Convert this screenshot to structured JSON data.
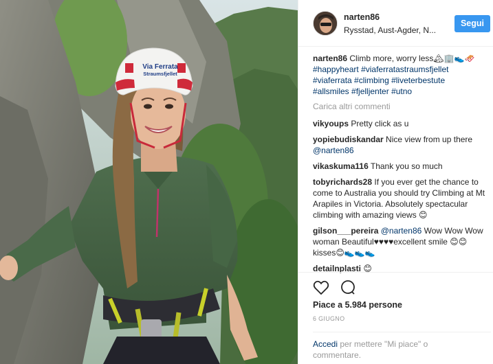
{
  "post": {
    "author": "narten86",
    "location": "Rysstad, Aust-Agder, N...",
    "follow_label": "Segui",
    "helmet_text_line1": "Via Ferrata",
    "helmet_text_line2": "Straumsfjellet"
  },
  "caption": {
    "user": "narten86",
    "text": "Climb more, worry less🏔🏢👟🛷",
    "hashtags": [
      "#happyheart",
      "#viaferratastraumsfjellet",
      "#viaferrata",
      "#climbing",
      "#liveterbestute",
      "#allsmiles",
      "#fjelljenter",
      "#utno"
    ]
  },
  "load_more_label": "Carica altri commenti",
  "comments": [
    {
      "user": "vikyoups",
      "text": "Pretty click as u"
    },
    {
      "user": "yopiebudiskandar",
      "text": "Nice view from up there ",
      "mention": "@narten86"
    },
    {
      "user": "vikaskuma116",
      "text": "Thank you so much"
    },
    {
      "user": "tobyrichards28",
      "text": "If you ever get the chance to come to Australia you should try Climbing at Mt Arapiles in Victoria. Absolutely spectacular climbing with amazing views 😊"
    },
    {
      "user": "gilson___pereira",
      "mention": "@narten86",
      "text": " Wow Wow Wow woman Beautiful♥♥♥♥excellent smile 😊😊 kisses😊👟👟👟"
    },
    {
      "user": "detailnplasti",
      "text": "😊"
    }
  ],
  "actions": {
    "likes": "Piace a 5.984 persone",
    "date": "6 GIUGNO",
    "login_link": "Accedi",
    "login_text": " per mettere \"Mi piace\" o commentare."
  },
  "colors": {
    "follow_button": "#3897f0",
    "link": "#003569",
    "muted": "#999999"
  }
}
